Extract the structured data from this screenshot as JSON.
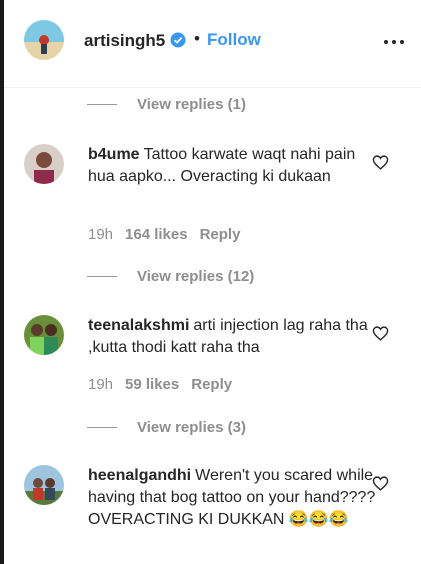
{
  "header": {
    "username": "artisingh5",
    "separator": "•",
    "follow_label": "Follow"
  },
  "view_replies": [
    {
      "label": "View replies (1)"
    },
    {
      "label": "View replies (12)"
    },
    {
      "label": "View replies (3)"
    }
  ],
  "comments": [
    {
      "username": "b4ume",
      "text": "Tattoo karwate waqt nahi pain hua aapko... Overacting ki dukaan",
      "time": "19h",
      "likes": "164 likes",
      "reply_label": "Reply"
    },
    {
      "username": "teenalakshmi",
      "text": "arti injection lag raha tha ,kutta thodi katt raha tha",
      "time": "19h",
      "likes": "59 likes",
      "reply_label": "Reply"
    },
    {
      "username": "heenalgandhi",
      "text": "Weren't you scared while having that bog tattoo on your hand???? OVERACTING KI DUKKAN 😂😂😂",
      "time": "",
      "likes": "",
      "reply_label": ""
    }
  ],
  "colors": {
    "link_blue": "#3897f0",
    "muted": "#8e8e8e",
    "text": "#262626"
  },
  "icons": [
    "verified-badge-icon",
    "more-options-icon",
    "heart-icon"
  ]
}
